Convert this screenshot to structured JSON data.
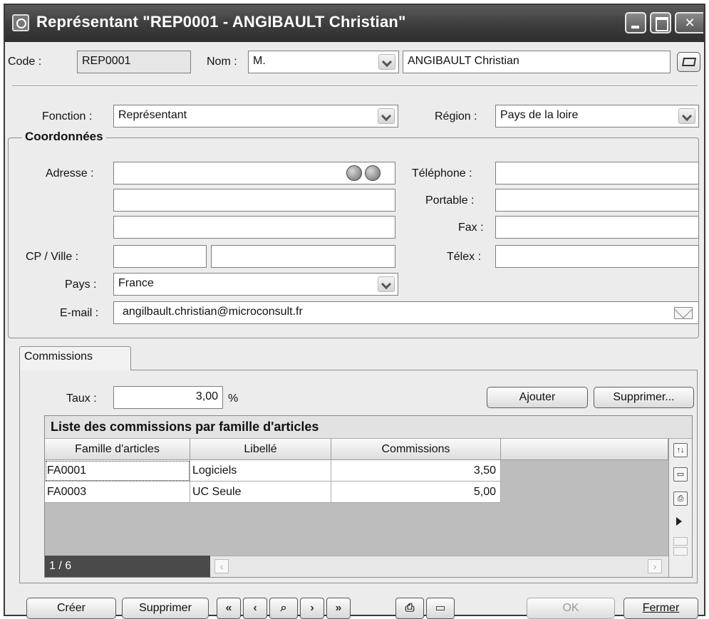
{
  "window": {
    "title": "Représentant \"REP0001 - ANGIBAULT Christian\""
  },
  "header": {
    "code_label": "Code :",
    "code_value": "REP0001",
    "nom_label": "Nom :",
    "civilite_value": "M.",
    "nom_value": "ANGIBAULT Christian"
  },
  "main": {
    "fonction_label": "Fonction :",
    "fonction_value": "Représentant",
    "region_label": "Région :",
    "region_value": "Pays de la loire"
  },
  "coordonnees": {
    "title": "Coordonnées",
    "adresse_label": "Adresse :",
    "adresse_lines": [
      "",
      "",
      ""
    ],
    "cp_ville_label": "CP / Ville :",
    "cp_value": "",
    "ville_value": "",
    "pays_label": "Pays :",
    "pays_value": "France",
    "email_label": "E-mail :",
    "email_value": "angilbault.christian@microconsult.fr",
    "telephone_label": "Téléphone :",
    "telephone_value": "",
    "portable_label": "Portable :",
    "portable_value": "",
    "fax_label": "Fax :",
    "fax_value": "",
    "telex_label": "Télex :",
    "telex_value": ""
  },
  "commissions": {
    "tab_label": "Commissions",
    "taux_label": "Taux :",
    "taux_value": "3,00",
    "taux_unit": "%",
    "ajouter_label": "Ajouter",
    "supprimer_label": "Supprimer...",
    "grid_title": "Liste des commissions par famille d'articles",
    "columns": [
      "Famille d'articles",
      "Libellé",
      "Commissions"
    ],
    "rows": [
      {
        "famille": "FA0001",
        "libelle": "Logiciels",
        "commissions": "3,50"
      },
      {
        "famille": "FA0003",
        "libelle": "UC Seule",
        "commissions": "5,00"
      }
    ],
    "counter": "1 / 6"
  },
  "footer": {
    "creer_label": "Créer",
    "supprimer_label": "Supprimer",
    "ok_label": "OK",
    "fermer_label": "Fermer"
  }
}
